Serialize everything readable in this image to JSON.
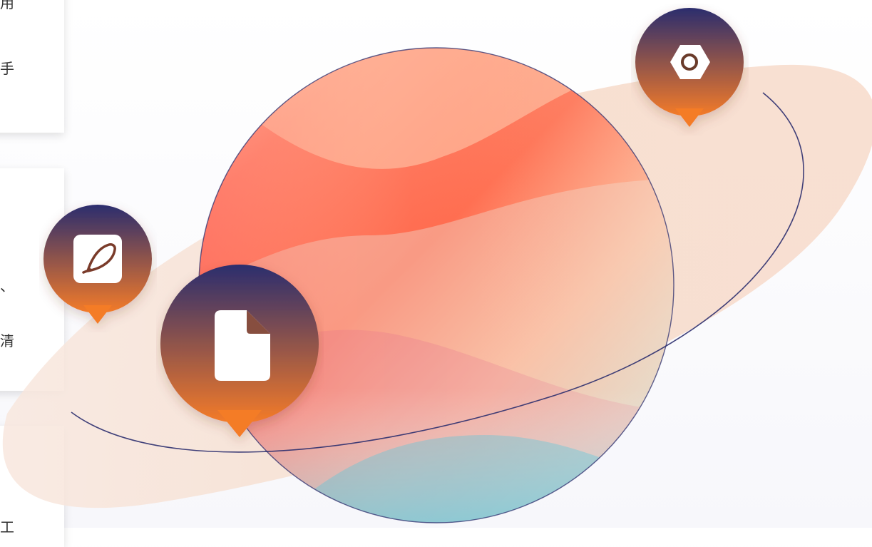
{
  "cards": [
    {
      "chars": [
        "用",
        "手"
      ]
    },
    {
      "chars": [
        "、",
        "清"
      ]
    },
    {
      "chars": [
        "工"
      ]
    }
  ],
  "pins": [
    {
      "icon": "gear-icon"
    },
    {
      "icon": "pencil-icon"
    },
    {
      "icon": "document-icon"
    }
  ],
  "colors": {
    "pin_top": "#2b2d6e",
    "pin_bottom": "#f47b28",
    "orbit": "#f6d9c6"
  }
}
